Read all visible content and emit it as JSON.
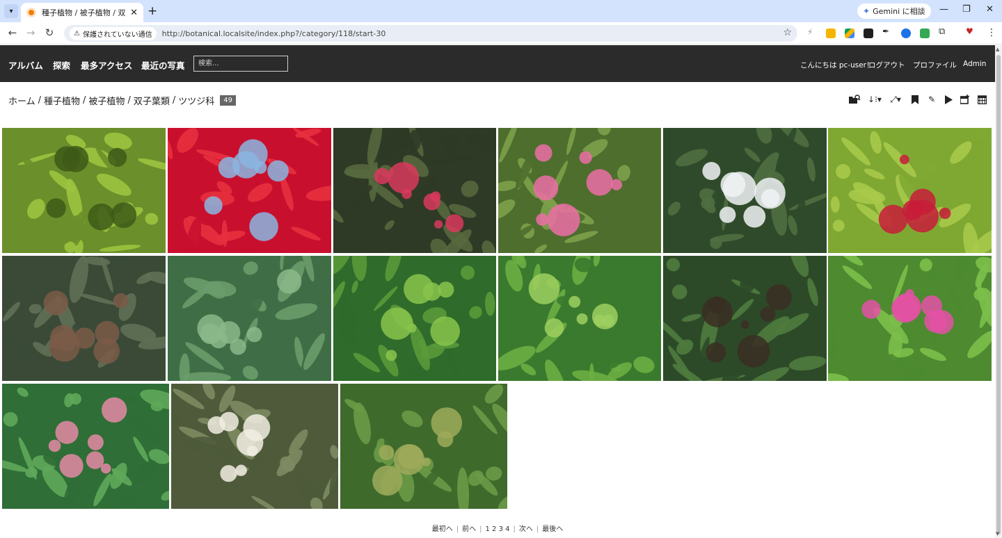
{
  "browser": {
    "tab_title": "種子植物 / 被子植物 / 双子葉類",
    "new_tab": "+",
    "gemini_label": "Gemini に相談",
    "secure_warning": "保護されていない通信",
    "url": "http://botanical.localsite/index.php?/category/118/start-30"
  },
  "nav": {
    "links": [
      "アルバム",
      "探索",
      "最多アクセス",
      "最近の写真"
    ],
    "search_placeholder": "検索...",
    "greeting": "こんにちは pc-user！",
    "logout": "ログアウト",
    "profile": "プロファイル",
    "admin": "Admin"
  },
  "breadcrumb": {
    "items": [
      "ホーム",
      "種子植物",
      "被子植物",
      "双子葉類",
      "ツツジ科"
    ],
    "separator": "/",
    "count": "49"
  },
  "actions": [
    "search-in-album-icon",
    "sort-icon",
    "photo-size-icon",
    "favorite-icon",
    "edit-icon",
    "slideshow-icon",
    "calendar-add-icon",
    "calendar-icon"
  ],
  "thumbnails": [
    {
      "name": "thumb-rhododendron-leaves-yellow",
      "palette": [
        "#6b8f2a",
        "#9cc43f",
        "#3e5a18"
      ]
    },
    {
      "name": "thumb-red-rhododendron-sky",
      "palette": [
        "#c8102e",
        "#e8303f",
        "#8ab6e0"
      ]
    },
    {
      "name": "thumb-pink-rhododendron-dark",
      "palette": [
        "#2f3a26",
        "#56683e",
        "#d93a5d"
      ]
    },
    {
      "name": "thumb-pink-azalea-flower",
      "palette": [
        "#4e6e2e",
        "#7da04a",
        "#ec6fa6"
      ]
    },
    {
      "name": "thumb-white-azalea",
      "palette": [
        "#2f4a2a",
        "#4f6e40",
        "#f0f2f4"
      ]
    },
    {
      "name": "thumb-red-azalea-buds",
      "palette": [
        "#7fa832",
        "#a9c94a",
        "#c81c3a"
      ]
    },
    {
      "name": "thumb-dark-rhododendron-leaves",
      "palette": [
        "#3a4a36",
        "#5f7056",
        "#7b5a48"
      ]
    },
    {
      "name": "thumb-green-rhododendron-leaves",
      "palette": [
        "#3f6e46",
        "#6a9b6a",
        "#8cb88a"
      ]
    },
    {
      "name": "thumb-needle-shrub-1",
      "palette": [
        "#2f6b2a",
        "#5a9a3a",
        "#88c44c"
      ]
    },
    {
      "name": "thumb-needle-shrub-2",
      "palette": [
        "#3a7a2e",
        "#6cae42",
        "#9ed060"
      ]
    },
    {
      "name": "thumb-azalea-shrub-leaves",
      "palette": [
        "#2d4a28",
        "#4f7b3e",
        "#3a2e22"
      ]
    },
    {
      "name": "thumb-pink-azalea-bush",
      "palette": [
        "#4d8a30",
        "#7cbf4a",
        "#e451a6"
      ]
    },
    {
      "name": "thumb-pink-pieris-buds",
      "palette": [
        "#2f6e36",
        "#5fa85a",
        "#e58aa6"
      ]
    },
    {
      "name": "thumb-white-bell-flowers",
      "palette": [
        "#4e5a3a",
        "#7d8a62",
        "#f1ede2"
      ]
    },
    {
      "name": "thumb-strawberry-tree-fruit",
      "palette": [
        "#3e6a2c",
        "#6a9a46",
        "#9eaa5a"
      ]
    }
  ],
  "pager": {
    "first": "最初へ",
    "prev": "前へ",
    "pages": "1 2 3 4",
    "next": "次へ",
    "last": "最後へ"
  }
}
